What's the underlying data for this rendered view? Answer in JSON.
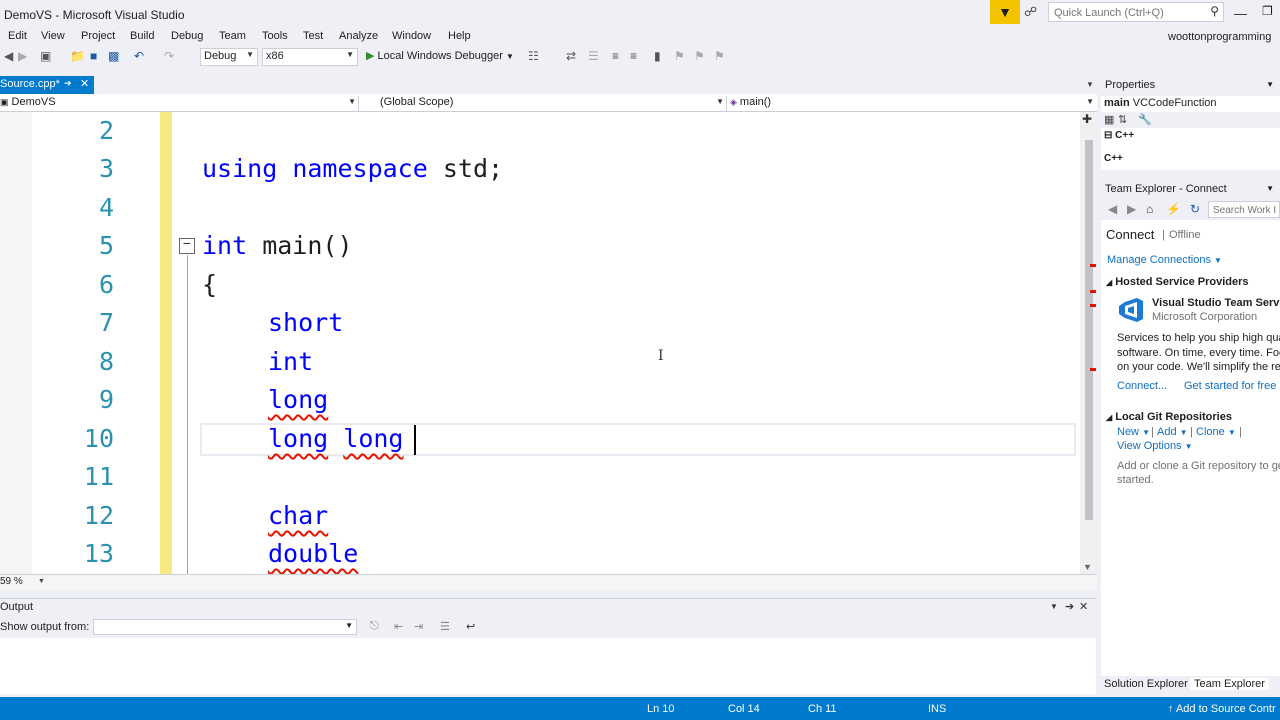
{
  "window": {
    "title": "DemoVS - Microsoft Visual Studio",
    "user": "woottonprogramming"
  },
  "quick_launch": {
    "placeholder": "Quick Launch (Ctrl+Q)"
  },
  "menu": [
    "Edit",
    "View",
    "Project",
    "Build",
    "Debug",
    "Team",
    "Tools",
    "Test",
    "Analyze",
    "Window",
    "Help"
  ],
  "toolbar": {
    "config": "Debug",
    "platform": "x86",
    "debugger": "Local Windows Debugger"
  },
  "tab": {
    "label": "Source.cpp*"
  },
  "navbar": {
    "project": "DemoVS",
    "scope": "(Global Scope)",
    "member": "main()"
  },
  "editor": {
    "line_numbers": [
      "2",
      "3",
      "4",
      "5",
      "6",
      "7",
      "8",
      "9",
      "10",
      "11",
      "12",
      "13"
    ],
    "code": {
      "l3_kw1": "using",
      "l3_kw2": "namespace",
      "l3_rest": " std;",
      "l5_kw": "int",
      "l5_rest": " main()",
      "l6": "{",
      "l7": "short",
      "l8": "int",
      "l9": "long",
      "l10a": "long",
      "l10b": "long",
      "l12": "char",
      "l13": "double"
    },
    "zoom": "59 %"
  },
  "output": {
    "title": "Output",
    "show_from_label": "Show output from:"
  },
  "properties": {
    "title": "Properties",
    "object_bold": "main",
    "object_type": "VCCodeFunction",
    "row1": "C++",
    "row2": "C++"
  },
  "team_explorer": {
    "title": "Team Explorer - Connect",
    "search_placeholder": "Search Work I",
    "connect": "Connect",
    "offline": "Offline",
    "manage": "Manage Connections",
    "hosted_header": "Hosted Service Providers",
    "vsts_name": "Visual Studio Team Service",
    "vsts_corp": "Microsoft Corporation",
    "desc1": "Services to help you ship high qual",
    "desc2": "software. On time, every time. Focu",
    "desc3": "on your code. We'll simplify the res",
    "connect_link": "Connect...",
    "get_started": "Get started for free",
    "git_header": "Local Git Repositories",
    "git_new": "New",
    "git_add": "Add",
    "git_clone": "Clone",
    "view_options": "View Options",
    "git_desc1": "Add or clone a Git repository to ge",
    "git_desc2": "started."
  },
  "bottom_tabs": {
    "solution": "Solution Explorer",
    "team": "Team Explorer"
  },
  "status": {
    "ln": "Ln 10",
    "col": "Col 14",
    "ch": "Ch 11",
    "ins": "INS",
    "source_control": "Add to Source Contr"
  },
  "colors": {
    "accent": "#007acc",
    "keyword": "#0000ff",
    "line_number": "#2b91af",
    "change_bar": "#f6e97f",
    "squiggle": "#e51400"
  }
}
